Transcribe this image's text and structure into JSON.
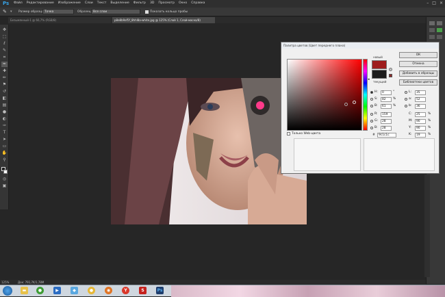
{
  "app": {
    "logo": "Ps"
  },
  "menu": [
    "Файл",
    "Редактирование",
    "Изображение",
    "Слои",
    "Текст",
    "Выделение",
    "Фильтр",
    "3D",
    "Просмотр",
    "Окно",
    "Справка"
  ],
  "options": {
    "size_label": "Размер образца:",
    "size_value": "Точка",
    "sample_label": "Образец:",
    "sample_value": "Все слои",
    "show_ring_label": "Показать кольцо пробы"
  },
  "tabs": [
    "Безымянный-1 @ 66,7% (RGB/8)",
    "p8e8b9af5f_8hhl8a-white.jpg @ 125% (Слой 1, Слой-маска/8)"
  ],
  "picker": {
    "title": "Палитра цветов (Цвет переднего плана)",
    "new_label": "новый",
    "current_label": "текущий",
    "new_color": "#9e1c1c",
    "current_color": "#1c1c1c",
    "ok": "ОК",
    "cancel": "Отмена",
    "add_swatch": "Добавить в образцы",
    "libraries": "Библиотеки цветов",
    "web_only": "Только Web-цвета",
    "fields": {
      "H": {
        "label": "H:",
        "value": "0",
        "unit": "°"
      },
      "S": {
        "label": "S:",
        "value": "82",
        "unit": "%"
      },
      "B": {
        "label": "B:",
        "value": "61",
        "unit": "%"
      },
      "R": {
        "label": "R:",
        "value": "159",
        "unit": ""
      },
      "G": {
        "label": "G:",
        "value": "28",
        "unit": ""
      },
      "Bl": {
        "label": "B:",
        "value": "28",
        "unit": ""
      },
      "L": {
        "label": "L:",
        "value": "35",
        "unit": ""
      },
      "a": {
        "label": "a:",
        "value": "52",
        "unit": ""
      },
      "b": {
        "label": "b:",
        "value": "36",
        "unit": ""
      },
      "C": {
        "label": "C:",
        "value": "25",
        "unit": "%"
      },
      "M": {
        "label": "M:",
        "value": "90",
        "unit": "%"
      },
      "Y": {
        "label": "Y:",
        "value": "90",
        "unit": "%"
      },
      "K": {
        "label": "K:",
        "value": "19",
        "unit": "%"
      },
      "hex": {
        "label": "#",
        "value": "9c1c1c"
      }
    }
  },
  "status": {
    "zoom": "125%",
    "doc": "Док: 791,7K/1,78M"
  }
}
